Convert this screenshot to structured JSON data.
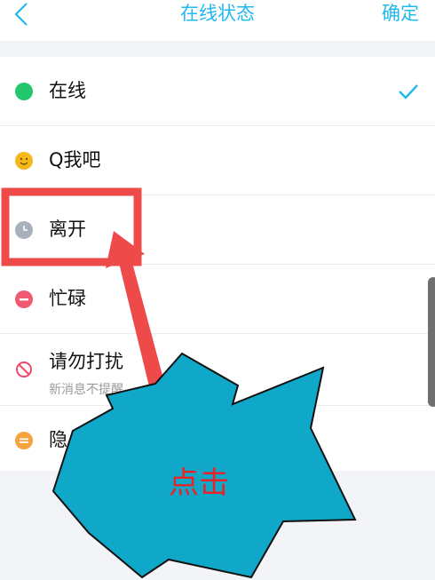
{
  "header": {
    "title": "在线状态",
    "confirm_label": "确定",
    "back_icon": "chevron-left-icon",
    "accent_color": "#23b8f0"
  },
  "status_list": [
    {
      "label": "在线",
      "icon": "online-dot-icon",
      "color": "#22c76c",
      "selected": true
    },
    {
      "label": "Q我吧",
      "icon": "smiley-icon",
      "color": "#f5b81b",
      "selected": false
    },
    {
      "label": "离开",
      "icon": "clock-icon",
      "color": "#a8b0bd",
      "selected": false
    },
    {
      "label": "忙碌",
      "icon": "busy-minus-icon",
      "color": "#ef5a72",
      "selected": false
    },
    {
      "label": "请勿打扰",
      "sublabel": "新消息不提醒",
      "icon": "no-disturb-icon",
      "color": "#ef4a6a",
      "selected": false
    },
    {
      "label": "隐身",
      "icon": "invisible-icon",
      "color": "#f5a33d",
      "selected": false
    }
  ],
  "annotation": {
    "callout_text": "点击",
    "highlight_color": "#ee4a4a",
    "burst_color": "#10a8c8"
  }
}
